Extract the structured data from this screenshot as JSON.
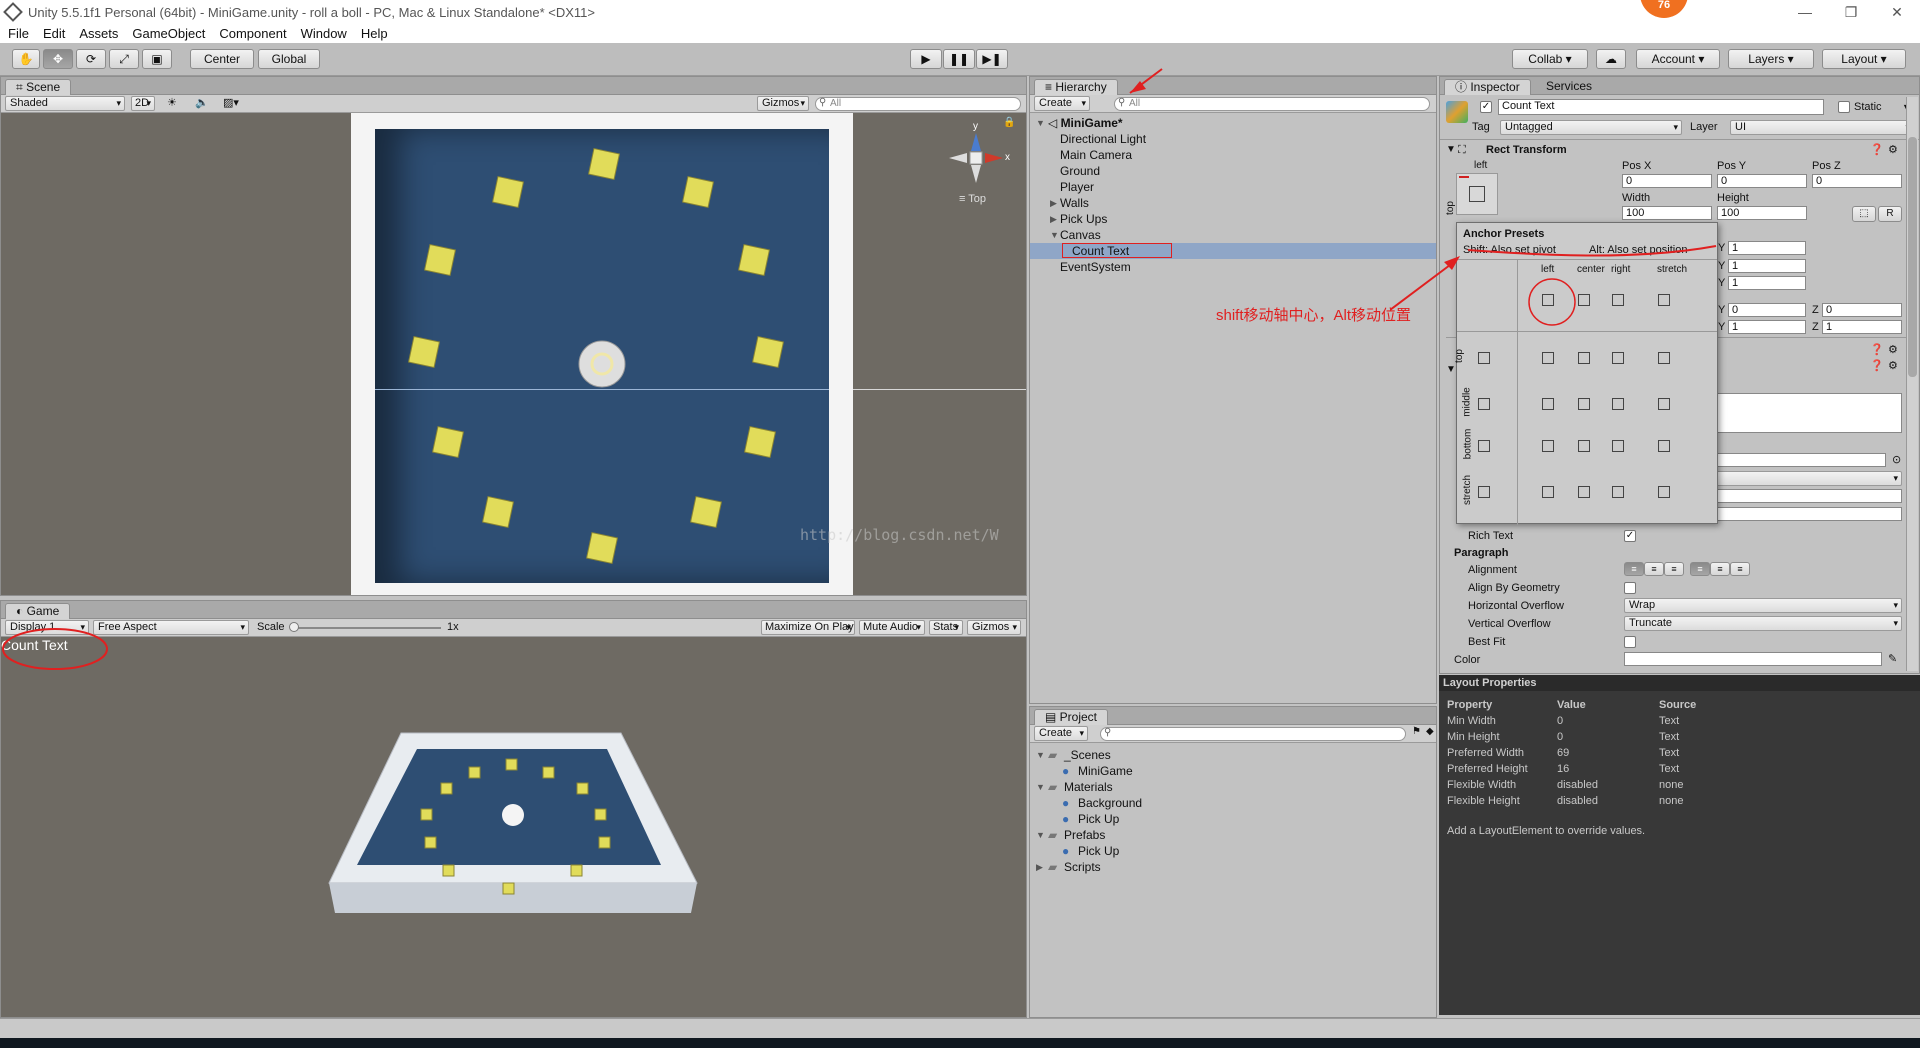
{
  "window": {
    "title": "Unity 5.5.1f1 Personal (64bit) - MiniGame.unity - roll a boll - PC, Mac & Linux Standalone* <DX11>",
    "collab_badge": "76"
  },
  "menu": [
    "File",
    "Edit",
    "Assets",
    "GameObject",
    "Component",
    "Window",
    "Help"
  ],
  "toolbar": {
    "pivot": "Center",
    "space": "Global",
    "collab": "Collab",
    "account": "Account",
    "layers": "Layers",
    "layout": "Layout"
  },
  "scene": {
    "tab": "Scene",
    "shading": "Shaded",
    "mode_2d": "2D",
    "gizmos": "Gizmos",
    "search_placeholder": "All",
    "view_label": "Top",
    "axis_y": "y",
    "axis_x": "x"
  },
  "game": {
    "tab": "Game",
    "display": "Display 1",
    "aspect": "Free Aspect",
    "scale_label": "Scale",
    "scale_value": "1x",
    "maximize": "Maximize On Play",
    "mute": "Mute Audio",
    "stats": "Stats",
    "gizmos": "Gizmos",
    "overlay_text": "Count Text"
  },
  "hierarchy": {
    "tab": "Hierarchy",
    "create": "Create",
    "search_placeholder": "All",
    "scene_name": "MiniGame*",
    "items": [
      {
        "label": "Directional Light",
        "depth": 1,
        "fold": ""
      },
      {
        "label": "Main Camera",
        "depth": 1,
        "fold": ""
      },
      {
        "label": "Ground",
        "depth": 1,
        "fold": ""
      },
      {
        "label": "Player",
        "depth": 1,
        "fold": ""
      },
      {
        "label": "Walls",
        "depth": 1,
        "fold": "▶"
      },
      {
        "label": "Pick Ups",
        "depth": 1,
        "fold": "▶"
      },
      {
        "label": "Canvas",
        "depth": 1,
        "fold": "▼"
      },
      {
        "label": "Count Text",
        "depth": 2,
        "fold": "",
        "selected": true
      },
      {
        "label": "EventSystem",
        "depth": 1,
        "fold": ""
      }
    ]
  },
  "project": {
    "tab": "Project",
    "create": "Create",
    "items": [
      {
        "label": "_Scenes",
        "depth": 0,
        "fold": "▼"
      },
      {
        "label": "MiniGame",
        "depth": 1,
        "fold": ""
      },
      {
        "label": "Materials",
        "depth": 0,
        "fold": "▼"
      },
      {
        "label": "Background",
        "depth": 1,
        "fold": ""
      },
      {
        "label": "Pick Up",
        "depth": 1,
        "fold": ""
      },
      {
        "label": "Prefabs",
        "depth": 0,
        "fold": "▼"
      },
      {
        "label": "Pick Up",
        "depth": 1,
        "fold": ""
      },
      {
        "label": "Scripts",
        "depth": 0,
        "fold": "▶"
      }
    ]
  },
  "inspector": {
    "tab": "Inspector",
    "services_tab": "Services",
    "object_name": "Count Text",
    "static_label": "Static",
    "tag_label": "Tag",
    "tag_value": "Untagged",
    "layer_label": "Layer",
    "layer_value": "UI",
    "rect_transform": "Rect Transform",
    "anchor_h": "left",
    "anchor_v": "top",
    "pos_x_label": "Pos X",
    "pos_x": "0",
    "pos_y_label": "Pos Y",
    "pos_y": "0",
    "pos_z_label": "Pos Z",
    "pos_z": "0",
    "width_label": "Width",
    "width": "100",
    "height_label": "Height",
    "height": "100",
    "r_button": "R",
    "side_y_label": "Y",
    "side_z_label": "Z",
    "side_values": [
      "1",
      "1",
      "1",
      "0",
      "0",
      "1",
      "1"
    ],
    "rich_text_label": "Rich Text",
    "paragraph_label": "Paragraph",
    "alignment_label": "Alignment",
    "align_geometry_label": "Align By Geometry",
    "h_overflow_label": "Horizontal Overflow",
    "h_overflow_value": "Wrap",
    "v_overflow_label": "Vertical Overflow",
    "v_overflow_value": "Truncate",
    "best_fit_label": "Best Fit",
    "color_label": "Color"
  },
  "anchor_presets": {
    "title": "Anchor Presets",
    "shift_hint": "Shift: Also set pivot",
    "alt_hint": "Alt: Also set position",
    "columns": [
      "left",
      "center",
      "right",
      "stretch"
    ],
    "rows": [
      "top",
      "middle",
      "bottom",
      "stretch"
    ]
  },
  "annotation": {
    "note": "shift移动轴中心，Alt移动位置",
    "watermark": "http://blog.csdn.net/W"
  },
  "layout_properties": {
    "title": "Layout Properties",
    "headers": [
      "Property",
      "Value",
      "Source"
    ],
    "rows": [
      [
        "Min Width",
        "0",
        "Text"
      ],
      [
        "Min Height",
        "0",
        "Text"
      ],
      [
        "Preferred Width",
        "69",
        "Text"
      ],
      [
        "Preferred Height",
        "16",
        "Text"
      ],
      [
        "Flexible Width",
        "disabled",
        "none"
      ],
      [
        "Flexible Height",
        "disabled",
        "none"
      ]
    ],
    "footer": "Add a LayoutElement to override values."
  },
  "colors": {
    "ground": "#2e4e73",
    "pickup": "#e1dc5a",
    "annotation_red": "#e02020",
    "selection": "#8fa6c7"
  }
}
